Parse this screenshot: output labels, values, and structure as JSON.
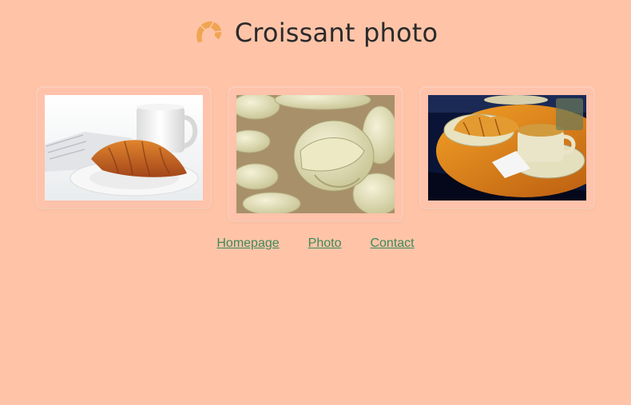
{
  "header": {
    "title": "Croissant photo",
    "logo_icon": "croissant-icon"
  },
  "gallery": {
    "photos": [
      {
        "subject": "croissant-on-plate-with-mug"
      },
      {
        "subject": "raw-croissant-dough"
      },
      {
        "subject": "croissants-and-coffee-on-table"
      }
    ]
  },
  "nav": {
    "links": [
      {
        "label": "Homepage"
      },
      {
        "label": "Photo"
      },
      {
        "label": "Contact"
      }
    ]
  },
  "colors": {
    "background": "#ffc4a8",
    "link": "#3c8a5a",
    "title": "#2a2a2a",
    "logo": "#f0a050"
  }
}
